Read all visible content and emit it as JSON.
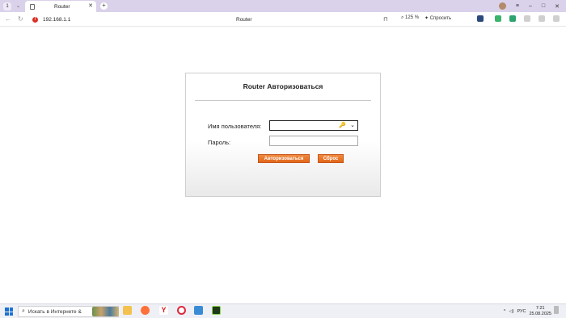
{
  "browser": {
    "tab_counter": "1",
    "tab_title": "Router",
    "new_tab_symbol": "+",
    "url": "192.168.1.1",
    "page_title": "Router",
    "zoom": "125 %",
    "ask_label": "Спросить",
    "window_controls": [
      "≡",
      "–",
      "□",
      "✕"
    ]
  },
  "login": {
    "heading": "Router Авторизоваться",
    "username_label": "Имя пользователя:",
    "username_value": "",
    "password_label": "Пароль:",
    "password_value": "",
    "login_button": "Авторизоваться",
    "reset_button": "Сброс"
  },
  "taskbar": {
    "search_text": "Искать в Интернете &",
    "language": "РУС",
    "time": "7:21",
    "date": "25.08.2025"
  },
  "colors": {
    "tabbar": "#dad2ea",
    "accent_button": "#e8711f",
    "taskbar": "#eef0f5"
  }
}
